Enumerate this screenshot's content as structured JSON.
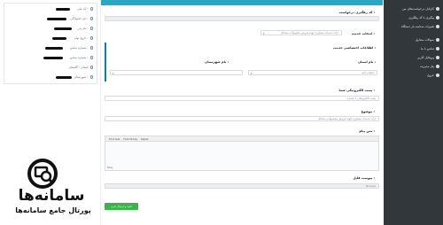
{
  "sidebar": {
    "items": [
      {
        "label": "کارتابل درخواست‌های من",
        "icon": "circle-icon"
      },
      {
        "label": "پیگیری با کد رهگیری",
        "icon": "circle-icon"
      },
      {
        "label": "تغییرات شناسه بار دستگاه",
        "icon": "circle-icon"
      },
      {
        "label": "سوالات متداول",
        "icon": "circle-icon"
      },
      {
        "label": "تماس با ما",
        "icon": "circle-icon"
      },
      {
        "label": "پروفایل کاربر",
        "icon": "circle-icon"
      },
      {
        "label": "پنل مدیریت",
        "icon": "circle-icon"
      },
      {
        "label": "خروج",
        "icon": "exit-icon"
      }
    ]
  },
  "user_panel": {
    "rows": [
      {
        "label": "کد ملی :"
      },
      {
        "label": "نام خانوادگی :"
      },
      {
        "label": "نام پدر :"
      },
      {
        "label": "تاریخ تولد :"
      },
      {
        "label": "شماره تماس :"
      },
      {
        "label": "شماره تماس :"
      },
      {
        "label": "استان : گلستان"
      },
      {
        "label": "شهرستان :"
      }
    ]
  },
  "logo": {
    "title": "سامانه‌ها",
    "subtitle": "پورتال جامع سامانه‌ها"
  },
  "form": {
    "tracking_label": "کد رهگیری درخواست :",
    "tracking_value": "",
    "service_label": "انتخاب خدمت :",
    "service_value": "ارائه خدمات مشاوره جهت فروش محصولات مشاغل",
    "service_section_label": "اطلاعات اختصاصی خدمت :",
    "province_label": "نام استان :",
    "province_value": "انتخاب کنید",
    "city_label": "نام شهرستان :",
    "city_value": "",
    "email_label": "پست الکترونیکی شما :",
    "email_placeholder": "پست الکترونیکی یا شماره",
    "subject_label": "موضوع :",
    "subject_value": "ارائه خدمات مشاوره جهت فروش محصولات مشاغل",
    "message_label": "متن پیام :",
    "editor_toolbar": [
      "Font size",
      "Font family",
      "Styles"
    ],
    "editor_status": "Body",
    "attachment_label": "پیوست فایل :",
    "attachment_button": "Browse",
    "submit_label": "تایید و ارسال فرم"
  },
  "colors": {
    "sidebar": "#32373c",
    "accent": "#2aa7c4",
    "section_border": "#0b7db3",
    "submit": "#3bb54a"
  }
}
